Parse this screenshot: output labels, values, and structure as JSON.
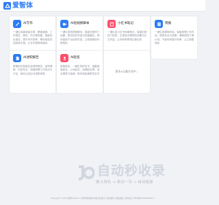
{
  "brand": {
    "name": "爱智体"
  },
  "cards": [
    {
      "title": "AI写作",
      "icon": "pen-icon",
      "color": "#2d7cf6",
      "desc": "一键生成高质量文章，覆盖营销、工作报告、邮件、作文等场景，智能优化语言，提升写作效率，帮你轻松完成各类文案，让写作更简单高效"
    },
    {
      "title": "AI短视频脚本",
      "icon": "video-icon",
      "color": "#2d7cf6",
      "desc": "一键生成短视频脚本，智能匹配热门话题，提供创作灵感与拍摄建议，助你高效产出优质内容，让短视频创作更轻松"
    },
    {
      "title": "小红书笔记",
      "icon": "book-icon",
      "color": "#ff4d6a",
      "desc": "一键生成小红书风格笔记，智能匹配热门标签，生成吸引眼球的标题与正文内容，让你的种草笔记更出彩"
    },
    {
      "title": "周报",
      "icon": "report-icon",
      "color": "#2d7cf6",
      "desc": "一键生成周报总结，智能梳理工作内容，提炼亮点与成果，清晰规划下周计划，节省时间提升效率，让汇报更轻松"
    },
    {
      "title": "AI述职报告",
      "icon": "doc-icon",
      "color": "#2d7cf6",
      "desc": "根据岗位智能生成述职报告，结构清晰、内容专业，快速梳理工作亮点与不足，助你从容应对述职考核"
    },
    {
      "title": "AI起名",
      "icon": "name-icon",
      "color": "#ff4d6a",
      "desc": "智能起名，一键生成好名字，涵盖宝宝起名、公司起名、品牌起名等，结合寓意与音律，助你找到满意的名字"
    }
  ],
  "add_card": {
    "label": "更多AI功能开发中..."
  },
  "watermark": {
    "title": "自动秒收录",
    "subtitle": "做上排名 → 来访一次 → 自动收录"
  },
  "footer": {
    "text": "Copyright © 2025 爱智体 aizhiti.cn 所有内容均由AI生成 仅供参考 | 联系我们 | 隐私政策 | 用户协议 | 粤ICP备2025000000号-1"
  }
}
